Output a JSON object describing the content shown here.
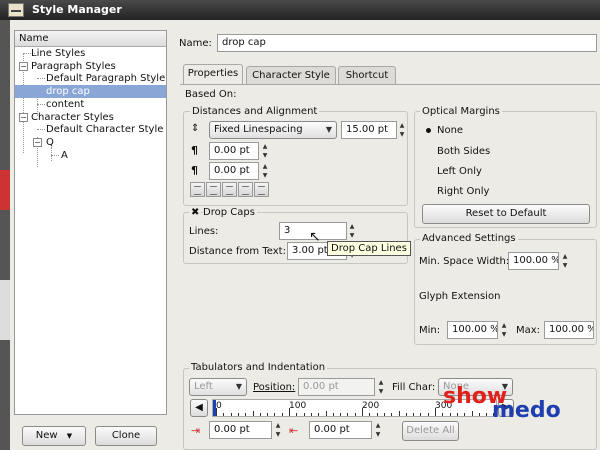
{
  "window": {
    "title": "Style Manager"
  },
  "tree": {
    "header": "Name",
    "items": [
      {
        "label": "Line Styles"
      },
      {
        "label": "Paragraph Styles"
      },
      {
        "label": "Default Paragraph Style"
      },
      {
        "label": "drop cap",
        "selected": true
      },
      {
        "label": "content"
      },
      {
        "label": "Character Styles"
      },
      {
        "label": "Default Character Style"
      },
      {
        "label": "Q"
      },
      {
        "label": "A"
      }
    ]
  },
  "buttons": {
    "new": "New",
    "clone": "Clone"
  },
  "name_field": {
    "label": "Name:",
    "value": "drop cap"
  },
  "tabs": [
    "Properties",
    "Character Style",
    "Shortcut"
  ],
  "based_on": "Based On:",
  "distances": {
    "title": "Distances and Alignment",
    "linespacing_mode": "Fixed Linespacing",
    "linespacing_value": "15.00 pt",
    "space_above": "0.00 pt",
    "space_below": "0.00 pt"
  },
  "drop_caps": {
    "title": "Drop Caps",
    "lines_label": "Lines:",
    "lines_value": "3",
    "distance_label": "Distance from Text:",
    "distance_value": "3.00 pt",
    "tooltip": "Drop Cap Lines"
  },
  "optical_margins": {
    "title": "Optical Margins",
    "options": [
      "None",
      "Both Sides",
      "Left Only",
      "Right Only"
    ],
    "selected": "None",
    "reset_button": "Reset to Default"
  },
  "advanced": {
    "title": "Advanced Settings",
    "min_space_label": "Min. Space Width:",
    "min_space_value": "100.00 %",
    "glyph_label": "Glyph Extension",
    "min_label": "Min:",
    "min_value": "100.00 %",
    "max_label": "Max:",
    "max_value": "100.00 %"
  },
  "tabulators": {
    "title": "Tabulators and Indentation",
    "align_value": "Left",
    "position_label": "Position:",
    "position_value": "0.00 pt",
    "fill_label": "Fill Char:",
    "fill_value": "None",
    "ruler_labels": [
      "0",
      "100",
      "200",
      "300"
    ],
    "indent_left": "0.00 pt",
    "indent_right": "0.00 pt",
    "delete_all": "Delete All"
  },
  "watermark": {
    "part1": "show",
    "part2": "medo"
  },
  "colors": {
    "selection": "#8aa6d6",
    "watermark_red": "#e0201a",
    "watermark_blue": "#1f3fb0"
  }
}
